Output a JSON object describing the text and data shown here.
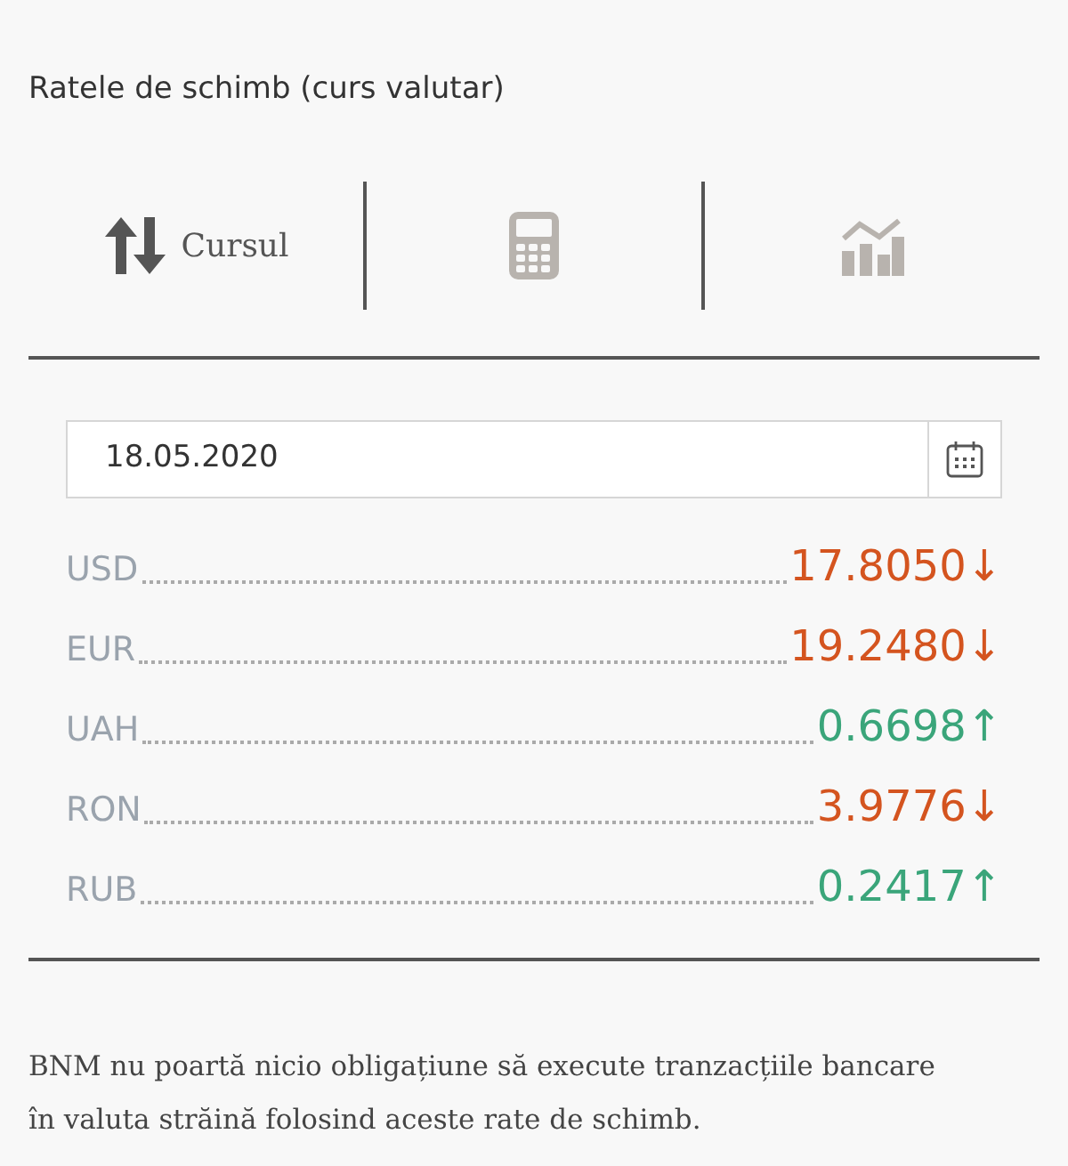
{
  "title": "Ratele de schimb (curs valutar)",
  "tabs": [
    {
      "kind": "rates",
      "label": "Cursul",
      "selected": true
    },
    {
      "kind": "calculator",
      "selected": false
    },
    {
      "kind": "chart",
      "selected": false
    }
  ],
  "date_field": {
    "value": "18.05.2020"
  },
  "rates": [
    {
      "code": "USD",
      "value": "17.8050",
      "arrow": "↓",
      "kind": "down"
    },
    {
      "code": "EUR",
      "value": "19.2480",
      "arrow": "↓",
      "kind": "down"
    },
    {
      "code": "UAH",
      "value": "0.6698",
      "arrow": "↑",
      "kind": "up"
    },
    {
      "code": "RON",
      "value": "3.9776",
      "arrow": "↓",
      "kind": "down"
    },
    {
      "code": "RUB",
      "value": "0.2417",
      "arrow": "↑",
      "kind": "up"
    }
  ],
  "disclaimer": "BNM nu poartă nicio obligațiune să execute tranzacțiile bancare în valuta străină folosind aceste rate de schimb."
}
